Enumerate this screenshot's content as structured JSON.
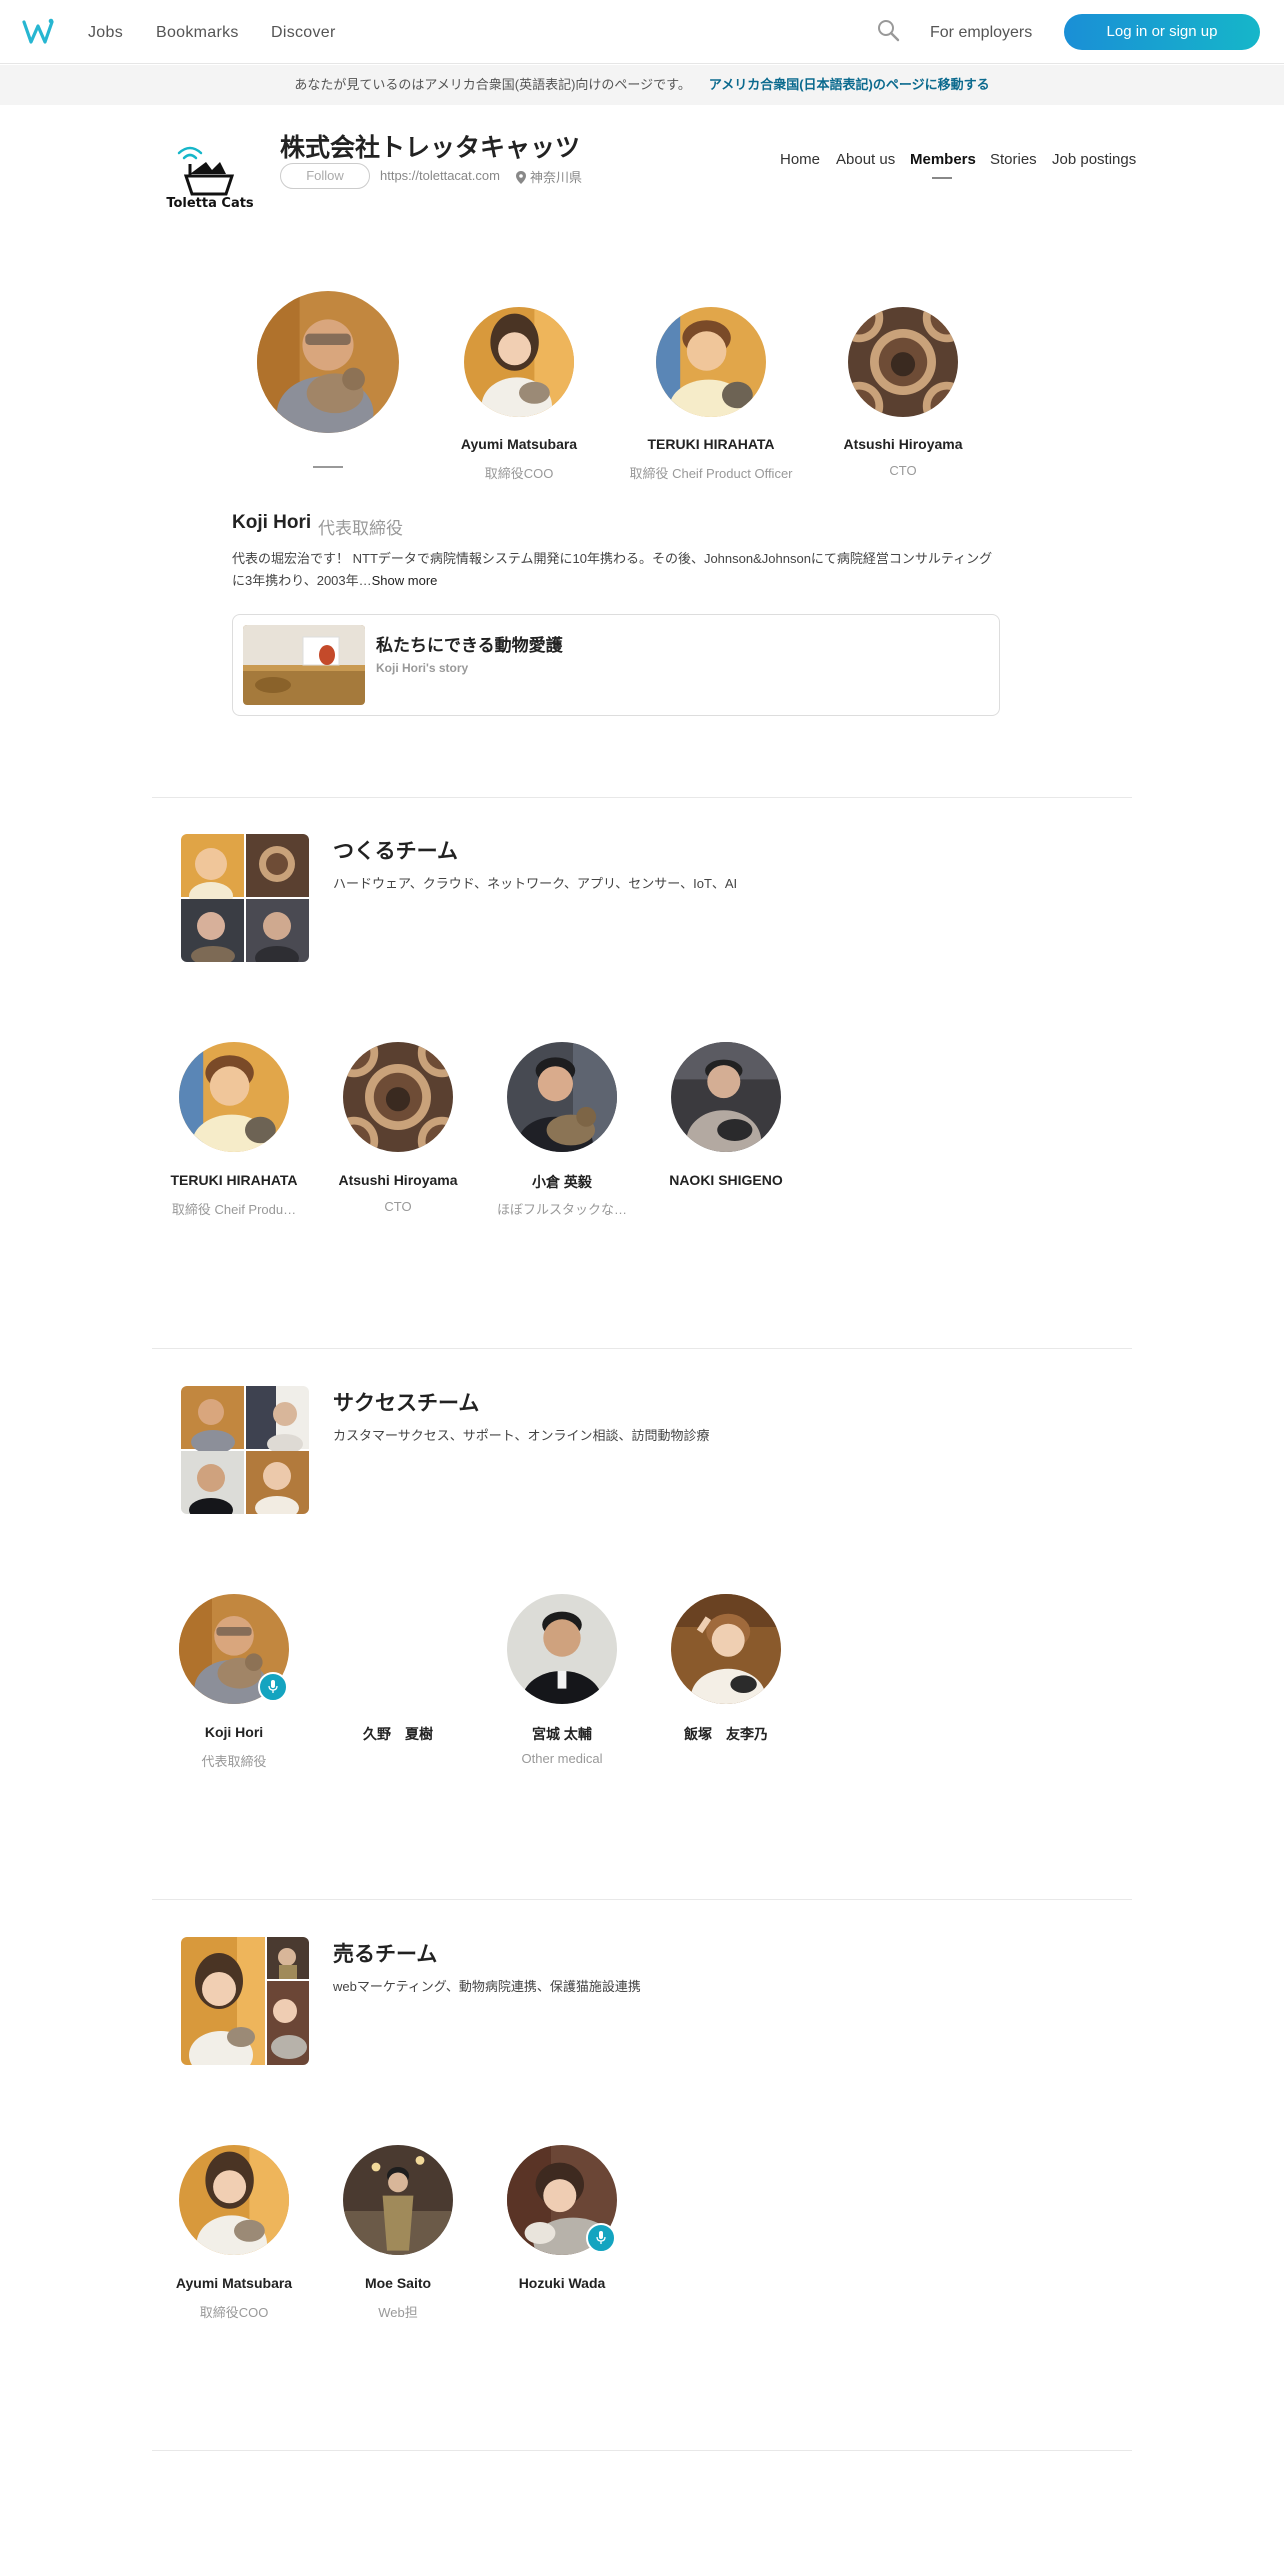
{
  "nav": {
    "links": [
      "Jobs",
      "Bookmarks",
      "Discover"
    ],
    "for_employers": "For employers",
    "login": "Log in or sign up"
  },
  "banner": {
    "notice": "あなたが見ているのはアメリカ合衆国(英語表記)向けのページです。",
    "jump": "アメリカ合衆国(日本語表記)のページに移動する"
  },
  "company": {
    "name": "株式会社トレッタキャッツ",
    "logo_text": "Toletta Cats",
    "follow": "Follow",
    "url": "https://tolettacat.com",
    "location": "神奈川県",
    "tabs": [
      "Home",
      "About us",
      "Members",
      "Stories",
      "Job postings"
    ],
    "active_tab": "Members"
  },
  "leaders": [
    {
      "name": "Ayumi Matsubara",
      "role": "取締役COO"
    },
    {
      "name": "TERUKI HIRAHATA",
      "role": "取締役 Cheif Product Officer"
    },
    {
      "name": "Atsushi Hiroyama",
      "role": "CTO"
    }
  ],
  "featured": {
    "name": "Koji Hori",
    "title": "代表取締役",
    "desc": "代表の堀宏治です！ NTTデータで病院情報システム開発に10年携わる。その後、Johnson&Johnsonにて病院経営コンサルティングに3年携わり、2003年…",
    "show_more": "Show more",
    "story_title": "私たちにできる動物愛護",
    "story_sub": "Koji Hori's story"
  },
  "teams": [
    {
      "title": "つくるチーム",
      "desc": "ハードウェア、クラウド、ネットワーク、アプリ、センサー、IoT、AI",
      "members": [
        {
          "name": "TERUKI HIRAHATA",
          "role": "取締役 Cheif Produ…"
        },
        {
          "name": "Atsushi Hiroyama",
          "role": "CTO"
        },
        {
          "name": "小倉 英毅",
          "role": "ほぼフルスタックな…"
        },
        {
          "name": "NAOKI SHIGENO",
          "role": ""
        }
      ]
    },
    {
      "title": "サクセスチーム",
      "desc": "カスタマーサクセス、サポート、オンライン相談、訪問動物診療",
      "members": [
        {
          "name": "Koji Hori",
          "role": "代表取締役"
        },
        {
          "name": "久野　夏樹",
          "role": ""
        },
        {
          "name": "宮城 太輔",
          "role": "Other medical"
        },
        {
          "name": "飯塚　友李乃",
          "role": ""
        }
      ]
    },
    {
      "title": "売るチーム",
      "desc": "webマーケティング、動物病院連携、保護猫施設連携",
      "members": [
        {
          "name": "Ayumi Matsubara",
          "role": "取締役COO"
        },
        {
          "name": "Moe Saito",
          "role": "Web担"
        },
        {
          "name": "Hozuki Wada",
          "role": ""
        }
      ]
    }
  ],
  "colors": {
    "accent": "#14a4c0",
    "login_gradient_start": "#1a8fd6",
    "login_gradient_end": "#16b6c9",
    "link": "#0b6a8e"
  }
}
